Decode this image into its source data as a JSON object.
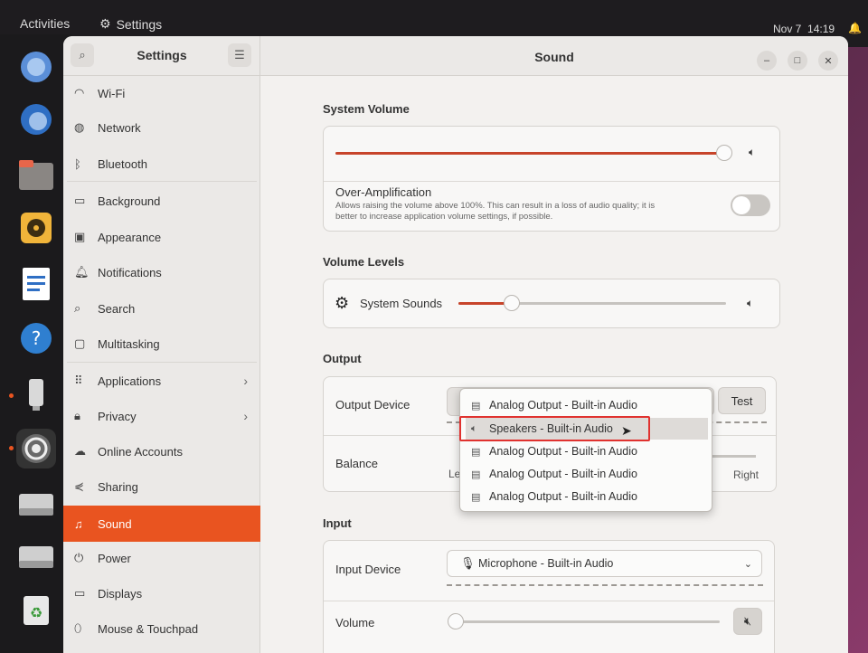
{
  "topbar": {
    "activities": "Activities",
    "app_name": "Settings",
    "date": "Nov 7",
    "time": "14:19"
  },
  "dock": {
    "items": [
      "chromium-icon",
      "thunderbird-icon",
      "files-icon",
      "rhythmbox-icon",
      "writer-icon",
      "help-icon",
      "usb-icon",
      "settings-icon",
      "drive-icon",
      "drive-icon",
      "trash-icon"
    ]
  },
  "window": {
    "sidebar_title": "Settings",
    "title": "Sound"
  },
  "sidebar": {
    "items": [
      {
        "label": "Wi-Fi",
        "icon": "wifi-icon"
      },
      {
        "label": "Network",
        "icon": "network-icon"
      },
      {
        "label": "Bluetooth",
        "icon": "bluetooth-icon"
      },
      {
        "label": "Background",
        "icon": "background-icon"
      },
      {
        "label": "Appearance",
        "icon": "appearance-icon"
      },
      {
        "label": "Notifications",
        "icon": "bell-icon"
      },
      {
        "label": "Search",
        "icon": "search-icon"
      },
      {
        "label": "Multitasking",
        "icon": "multitasking-icon"
      },
      {
        "label": "Applications",
        "icon": "apps-icon"
      },
      {
        "label": "Privacy",
        "icon": "lock-icon"
      },
      {
        "label": "Online Accounts",
        "icon": "cloud-icon"
      },
      {
        "label": "Sharing",
        "icon": "share-icon"
      },
      {
        "label": "Sound",
        "icon": "music-icon"
      },
      {
        "label": "Power",
        "icon": "power-icon"
      },
      {
        "label": "Displays",
        "icon": "display-icon"
      },
      {
        "label": "Mouse & Touchpad",
        "icon": "mouse-icon"
      }
    ],
    "active": "Sound"
  },
  "sound": {
    "system_volume": {
      "title": "System Volume",
      "level": 0.99,
      "over_amp_title": "Over-Amplification",
      "over_amp_desc_1": "Allows raising the volume above 100%. This can result in a loss of audio quality; it is",
      "over_amp_desc_2": "better to increase application volume settings, if possible.",
      "over_amp_enabled": false
    },
    "volume_levels": {
      "title": "Volume Levels",
      "system_sounds_label": "System Sounds",
      "system_sounds_level": 0.2
    },
    "output": {
      "title": "Output",
      "device_label": "Output Device",
      "test_button": "Test",
      "balance_label": "Balance",
      "balance_left": "Le",
      "balance_right": "Right",
      "dropdown_options": [
        "Analog Output - Built-in Audio",
        "Speakers - Built-in Audio",
        "Analog Output - Built-in Audio",
        "Analog Output - Built-in Audio",
        "Analog Output - Built-in Audio"
      ],
      "selected_option": "Speakers - Built-in Audio"
    },
    "input": {
      "title": "Input",
      "device_label": "Input Device",
      "device_value": "Microphone - Built-in Audio",
      "volume_label": "Volume",
      "volume_level": 0.0
    }
  },
  "colors": {
    "accent": "#e95420",
    "highlight": "#e0322f"
  }
}
